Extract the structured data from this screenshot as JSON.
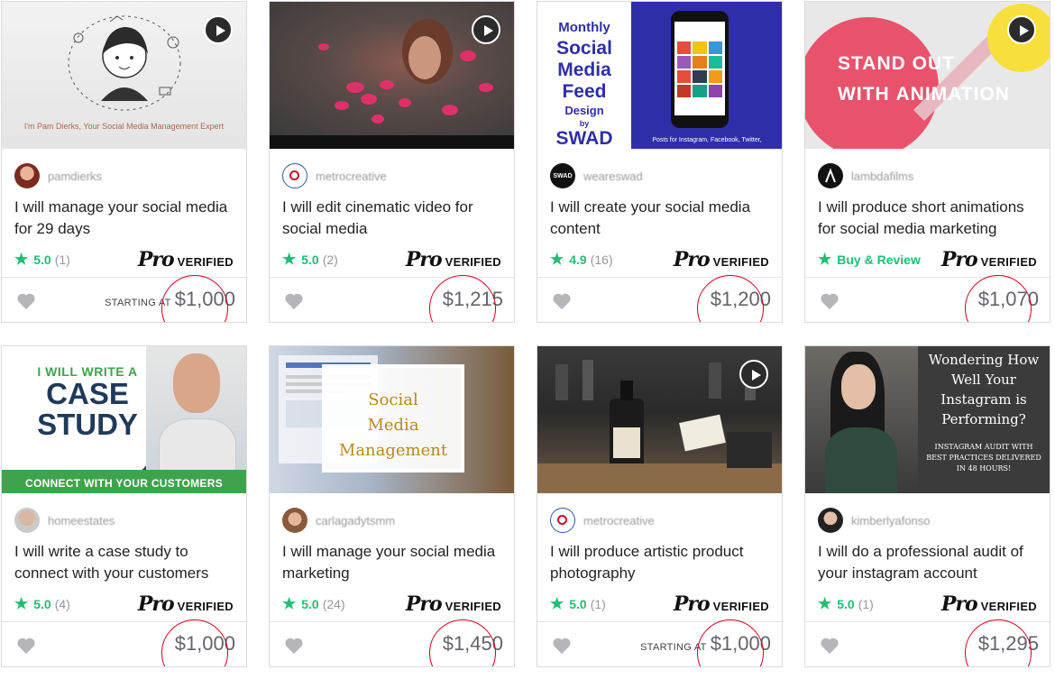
{
  "cards": [
    {
      "seller": "pamdierks",
      "title": "I will manage your social media for 29 days",
      "rating": "5.0",
      "reviews": "(1)",
      "starting": "STARTING AT",
      "price": "$1,000",
      "thumb_text": "I'm Pam Dierks, Your Social Media Management Expert",
      "has_play": true
    },
    {
      "seller": "metrocreative",
      "title": "I will edit cinematic video for social media",
      "rating": "5.0",
      "reviews": "(2)",
      "starting": "",
      "price": "$1,215",
      "has_play": true
    },
    {
      "seller": "weareswad",
      "title": "I will create your social media content",
      "rating": "4.9",
      "reviews": "(16)",
      "starting": "",
      "price": "$1,200",
      "thumb_text": [
        "Monthly",
        "Social",
        "Media",
        "Feed",
        "Design",
        "by",
        "SWAD"
      ],
      "thumb_caption": "Posts for Instagram, Facebook, Twitter,",
      "avatar_text": "SWAD"
    },
    {
      "seller": "lambdafilms",
      "title": "I will produce short animations for social media marketing",
      "buy_review": "Buy & Review",
      "starting": "",
      "price": "$1,070",
      "thumb_text": [
        "STAND OUT",
        "WITH",
        "ANIMATION"
      ],
      "has_play": true
    },
    {
      "seller": "homeestates",
      "title": "I will write a case study to connect with your customers",
      "rating": "5.0",
      "reviews": "(4)",
      "starting": "",
      "price": "$1,000",
      "thumb_text": [
        "I WILL WRITE A",
        "CASE",
        "STUDY",
        "CONNECT WITH YOUR CUSTOMERS"
      ]
    },
    {
      "seller": "carlagadytsmm",
      "title": "I will manage your social media marketing",
      "rating": "5.0",
      "reviews": "(24)",
      "starting": "",
      "price": "$1,450",
      "thumb_text": [
        "Social",
        "Media",
        "Management"
      ]
    },
    {
      "seller": "metrocreative",
      "title": "I will produce artistic product photography",
      "rating": "5.0",
      "reviews": "(1)",
      "starting": "STARTING AT",
      "price": "$1,000",
      "has_play": true
    },
    {
      "seller": "kimberlyafonso",
      "title": "I will do a professional audit of your instagram account",
      "rating": "5.0",
      "reviews": "(1)",
      "starting": "",
      "price": "$1,295",
      "thumb_text": [
        "Wondering How",
        "Well Your",
        "Instagram is",
        "Performing?",
        "INSTAGRAM AUDIT WITH",
        "BEST PRACTICES DELIVERED",
        "IN 48 HOURS!"
      ]
    }
  ],
  "pro_badge": {
    "pro": "Pro",
    "verified": "VERIFIED"
  },
  "colors": {
    "rating_green": "#1dbf73",
    "annotation_red": "#d0021b",
    "border": "#dadbdd"
  },
  "icons": {
    "star": "star-icon",
    "heart": "heart-icon",
    "play": "play-icon"
  }
}
